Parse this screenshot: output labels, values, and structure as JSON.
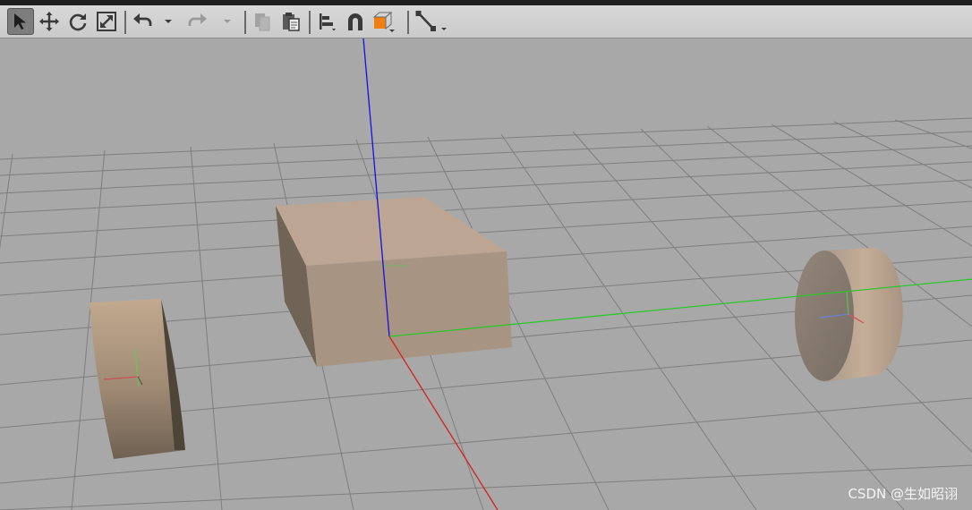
{
  "toolbar": {
    "tools": [
      {
        "name": "select-mode-button",
        "icon": "pointer-arrow-icon",
        "active": true
      },
      {
        "name": "translate-mode-button",
        "icon": "move-arrows-icon"
      },
      {
        "name": "rotate-mode-button",
        "icon": "rotate-icon"
      },
      {
        "name": "scale-mode-button",
        "icon": "scale-icon"
      },
      {
        "name": "undo-button",
        "icon": "undo-icon"
      },
      {
        "name": "undo-history-dropdown",
        "icon": "chevron-down-icon"
      },
      {
        "name": "redo-button",
        "icon": "redo-icon",
        "disabled": true
      },
      {
        "name": "redo-history-dropdown",
        "icon": "chevron-down-icon",
        "disabled": true
      },
      {
        "name": "copy-button",
        "icon": "copy-icon",
        "disabled": true
      },
      {
        "name": "paste-button",
        "icon": "paste-icon"
      },
      {
        "name": "align-button",
        "icon": "align-icon"
      },
      {
        "name": "snap-button",
        "icon": "magnet-icon"
      },
      {
        "name": "change-view-button",
        "icon": "view-cube-icon",
        "accent": "#f07f0f"
      },
      {
        "name": "joint-tool-button",
        "icon": "joint-icon"
      }
    ]
  },
  "scene": {
    "background_color": "#a8a8a8",
    "grid_color": "#7e7e7e",
    "axis_colors": {
      "x": "#d42020",
      "y": "#28c828",
      "z": "#1010e6"
    },
    "model_color": "#b8a08a",
    "objects": [
      "chassis-box",
      "left-wheel-cylinder",
      "right-wheel-cylinder"
    ]
  },
  "watermark": "CSDN @生如昭诩"
}
